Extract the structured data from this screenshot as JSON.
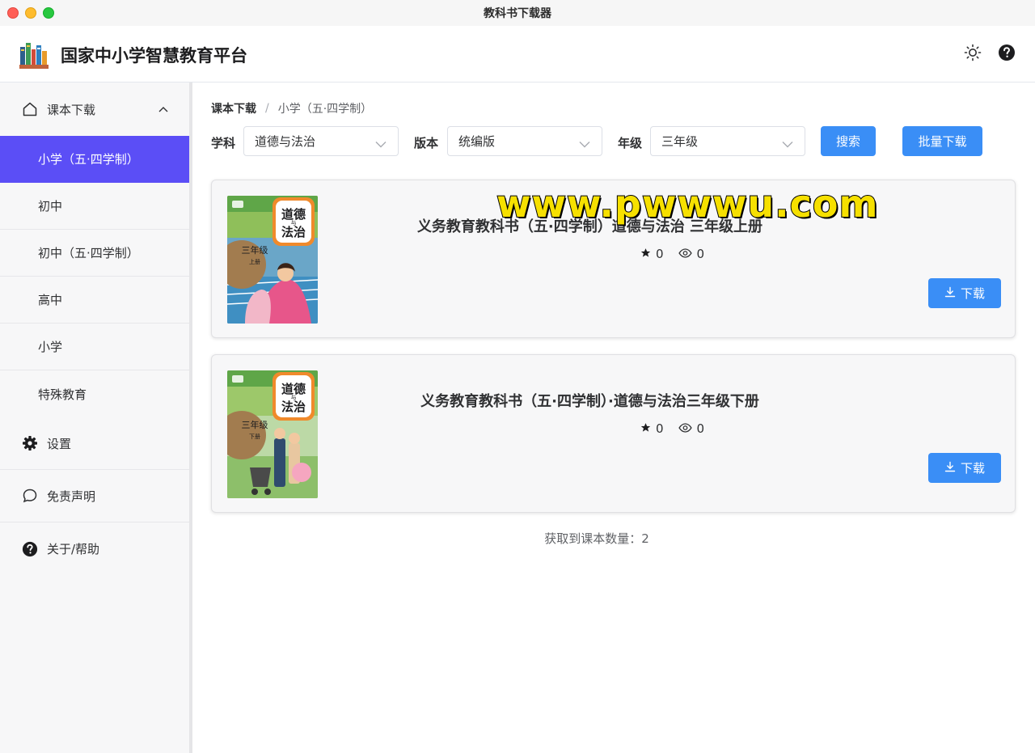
{
  "window": {
    "title": "教科书下载器"
  },
  "header": {
    "app_title": "国家中小学智慧教育平台",
    "theme_icon": "sun-icon",
    "help_icon": "question-circle-icon"
  },
  "sidebar": {
    "group": {
      "label": "课本下载",
      "icon": "home-icon",
      "expanded": true
    },
    "sub_items": [
      {
        "label": "小学（五·四学制）",
        "active": true
      },
      {
        "label": "初中"
      },
      {
        "label": "初中（五·四学制）"
      },
      {
        "label": "高中"
      },
      {
        "label": "小学"
      },
      {
        "label": "特殊教育"
      }
    ],
    "items": [
      {
        "label": "设置",
        "icon": "gear-icon"
      },
      {
        "label": "免责声明",
        "icon": "chat-bubble-icon"
      },
      {
        "label": "关于/帮助",
        "icon": "question-circle-icon"
      }
    ]
  },
  "breadcrumb": {
    "root": "课本下载",
    "separator": "/",
    "current": "小学（五·四学制）"
  },
  "filters": {
    "subject": {
      "label": "学科",
      "value": "道德与法治"
    },
    "edition": {
      "label": "版本",
      "value": "统编版"
    },
    "grade": {
      "label": "年级",
      "value": "三年级"
    },
    "search_label": "搜索",
    "batch_label": "批量下载"
  },
  "books": [
    {
      "title": "义务教育教科书（五·四学制）道德与法治 三年级上册",
      "stars": "0",
      "views": "0",
      "download_label": "下载",
      "cover": {
        "title_top": "道德",
        "title_mid": "与",
        "title_bottom": "法治",
        "grade": "三年级",
        "term": "上册"
      }
    },
    {
      "title": "义务教育教科书（五·四学制）·道德与法治三年级下册",
      "stars": "0",
      "views": "0",
      "download_label": "下载",
      "cover": {
        "title_top": "道德",
        "title_mid": "与",
        "title_bottom": "法治",
        "grade": "三年级",
        "term": "下册"
      }
    }
  ],
  "watermark": "www.pwwwu.com",
  "footer": {
    "count_label": "获取到课本数量：",
    "count_value": "2"
  },
  "colors": {
    "accent": "#3a8ef6",
    "active_menu": "#5b4ef6",
    "watermark_fill": "#f6e000"
  }
}
